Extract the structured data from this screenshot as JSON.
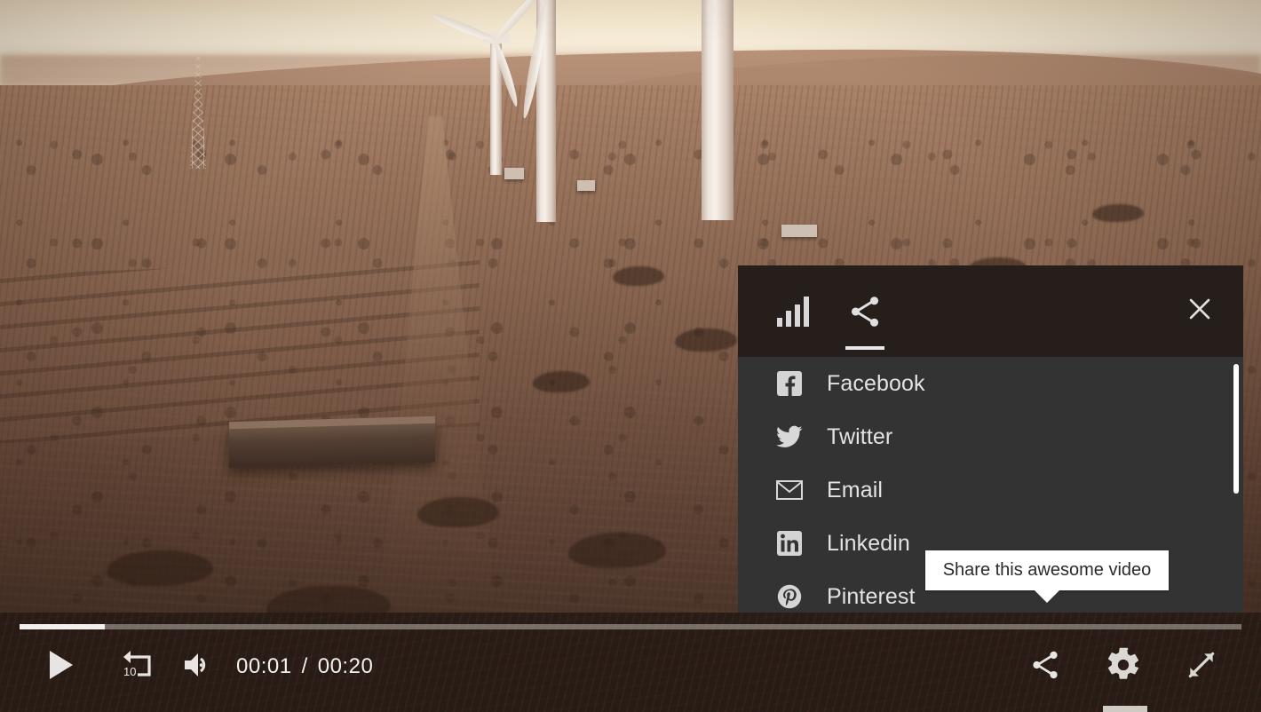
{
  "player": {
    "video_scene_description": "Aerial drone footage of a wind farm at sunset over arid plains with dirt roads",
    "accent_color": "#f2f0ee",
    "control_bar_color": "#261b15",
    "panel_header_color": "#261e1b",
    "panel_body_color": "#333333"
  },
  "share_panel": {
    "tabs": [
      {
        "id": "stats",
        "icon": "bar-chart-icon",
        "label": "Stats",
        "active": false
      },
      {
        "id": "share",
        "icon": "share-icon",
        "label": "Share",
        "active": true
      }
    ],
    "close_label": "Close",
    "close_icon": "close-icon",
    "items": [
      {
        "label": "Facebook",
        "icon": "facebook-icon"
      },
      {
        "label": "Twitter",
        "icon": "twitter-icon"
      },
      {
        "label": "Email",
        "icon": "email-icon"
      },
      {
        "label": "Linkedin",
        "icon": "linkedin-icon"
      },
      {
        "label": "Pinterest",
        "icon": "pinterest-icon"
      }
    ]
  },
  "tooltip": {
    "text": "Share this awesome video"
  },
  "controls": {
    "progress_percent": 7,
    "play_label": "Play",
    "play_icon": "play-icon",
    "rewind_label": "Rewind 10 seconds",
    "rewind_icon": "rewind-10-icon",
    "rewind_seconds": "10",
    "volume_label": "Volume",
    "volume_icon": "volume-icon",
    "current_time": "00:01",
    "time_separator": "/",
    "total_time": "00:20",
    "share_label": "Share",
    "share_icon": "share-icon",
    "settings_label": "Settings",
    "settings_icon": "gear-icon",
    "fullscreen_label": "Fullscreen",
    "fullscreen_icon": "fullscreen-expand-icon"
  }
}
